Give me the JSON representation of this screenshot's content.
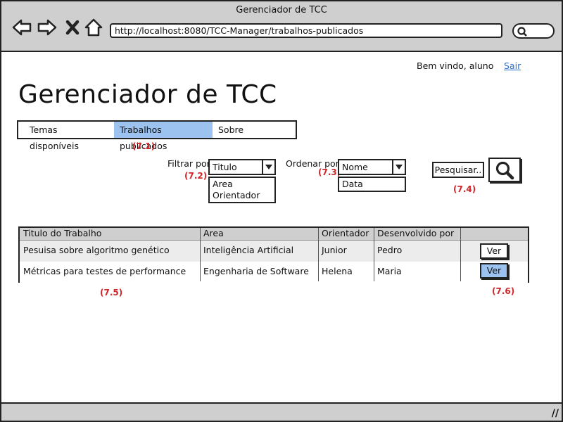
{
  "window": {
    "title": "Gerenciador de TCC"
  },
  "browser": {
    "url": "http://localhost:8080/TCC-Manager/trabalhos-publicados"
  },
  "header": {
    "welcome": "Bem vindo, aluno",
    "logout": "Sair"
  },
  "page": {
    "title": "Gerenciador de TCC"
  },
  "tabs": [
    {
      "label": "Temas disponíveis",
      "selected": false
    },
    {
      "label": "Trabalhos publicados",
      "selected": true
    },
    {
      "label": "Sobre",
      "selected": false
    }
  ],
  "annotations": {
    "tabs": "(7.1)",
    "filter": "(7.2)",
    "order": "(7.3)",
    "search": "(7.4)",
    "table": "(7.5)",
    "view": "(7.6)"
  },
  "filter": {
    "label": "Filtrar por",
    "selected": "Titulo",
    "options": [
      "Area",
      "Orientador"
    ]
  },
  "order": {
    "label": "Ordenar por",
    "selected": "Nome",
    "options": [
      "Data"
    ]
  },
  "search": {
    "placeholder": "Pesquisar.."
  },
  "table": {
    "columns": [
      "Titulo do Trabalho",
      "Area",
      "Orientador",
      "Desenvolvido por",
      ""
    ],
    "rows": [
      {
        "title": "Pesuisa sobre algoritmo genético",
        "area": "Inteligência Artificial",
        "advisor": "Junior",
        "author": "Pedro",
        "action": "Ver"
      },
      {
        "title": "Métricas para testes de performance",
        "area": "Engenharia de Software",
        "advisor": "Helena",
        "author": "Maria",
        "action": "Ver"
      }
    ]
  },
  "colors": {
    "accent": "#9cc3ef",
    "link": "#2b6fcf",
    "annotation": "#d0262b",
    "chrome": "#cfcfcf"
  }
}
